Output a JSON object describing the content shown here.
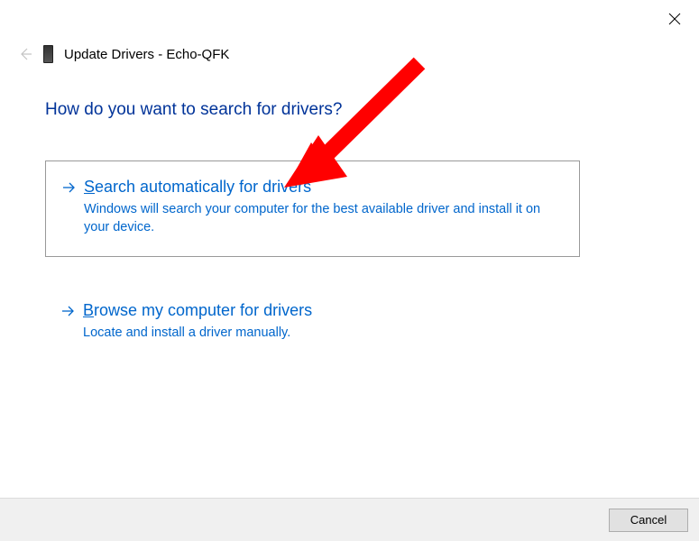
{
  "window": {
    "title": "Update Drivers - Echo-QFK"
  },
  "heading": "How do you want to search for drivers?",
  "options": [
    {
      "title_prefix": "S",
      "title_rest": "earch automatically for drivers",
      "description": "Windows will search your computer for the best available driver and install it on your device."
    },
    {
      "title_prefix": "B",
      "title_rest": "rowse my computer for drivers",
      "description": "Locate and install a driver manually."
    }
  ],
  "footer": {
    "cancel_label": "Cancel"
  }
}
